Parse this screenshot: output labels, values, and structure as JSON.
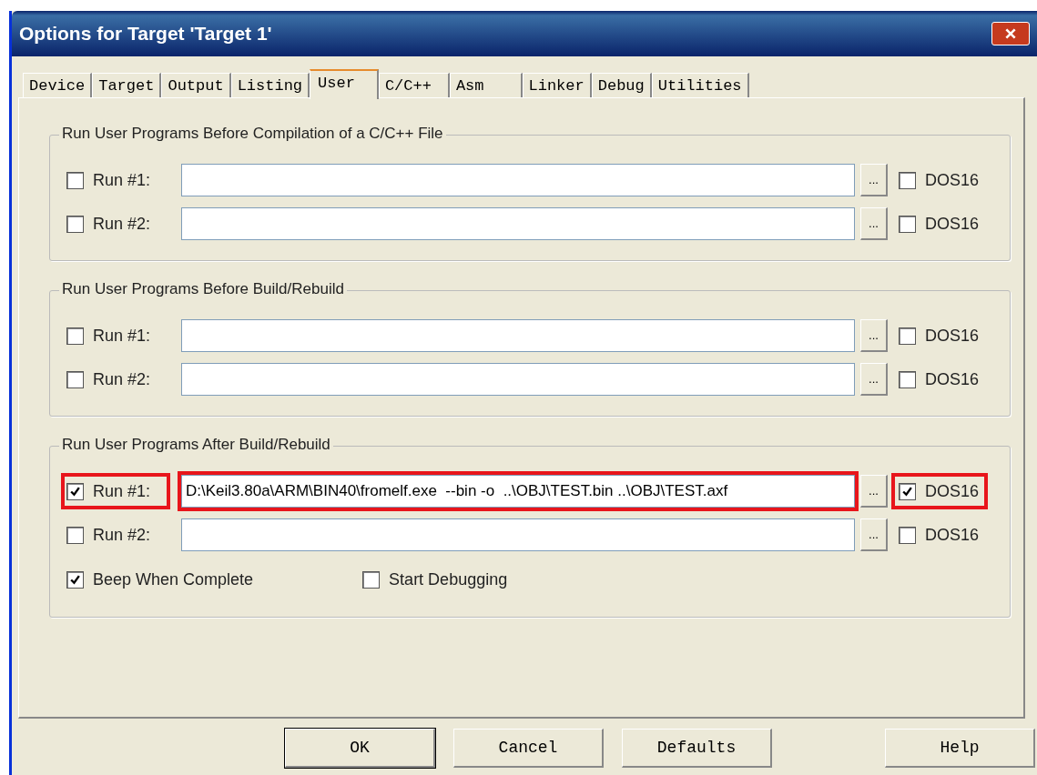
{
  "window": {
    "title": "Options for Target 'Target 1'"
  },
  "tabs": [
    {
      "label": "Device",
      "selected": false
    },
    {
      "label": "Target",
      "selected": false
    },
    {
      "label": "Output",
      "selected": false
    },
    {
      "label": "Listing",
      "selected": false
    },
    {
      "label": "User",
      "selected": true
    },
    {
      "label": "C/C++",
      "selected": false
    },
    {
      "label": "Asm",
      "selected": false
    },
    {
      "label": "Linker",
      "selected": false
    },
    {
      "label": "Debug",
      "selected": false
    },
    {
      "label": "Utilities",
      "selected": false
    }
  ],
  "groups": [
    {
      "title": "Run User Programs Before Compilation of a C/C++ File",
      "rows": [
        {
          "label": "Run #1:",
          "checked": false,
          "value": "",
          "browse": "...",
          "dos_label": "DOS16",
          "dos_checked": false,
          "highlighted": false
        },
        {
          "label": "Run #2:",
          "checked": false,
          "value": "",
          "browse": "...",
          "dos_label": "DOS16",
          "dos_checked": false,
          "highlighted": false
        }
      ]
    },
    {
      "title": "Run User Programs Before Build/Rebuild",
      "rows": [
        {
          "label": "Run #1:",
          "checked": false,
          "value": "",
          "browse": "...",
          "dos_label": "DOS16",
          "dos_checked": false,
          "highlighted": false
        },
        {
          "label": "Run #2:",
          "checked": false,
          "value": "",
          "browse": "...",
          "dos_label": "DOS16",
          "dos_checked": false,
          "highlighted": false
        }
      ]
    },
    {
      "title": "Run User Programs After Build/Rebuild",
      "rows": [
        {
          "label": "Run #1:",
          "checked": true,
          "value": "D:\\Keil3.80a\\ARM\\BIN40\\fromelf.exe  --bin -o  ..\\OBJ\\TEST.bin ..\\OBJ\\TEST.axf",
          "browse": "...",
          "dos_label": "DOS16",
          "dos_checked": true,
          "highlighted": true
        },
        {
          "label": "Run #2:",
          "checked": false,
          "value": "",
          "browse": "...",
          "dos_label": "DOS16",
          "dos_checked": false,
          "highlighted": false
        }
      ],
      "options": [
        {
          "label": "Beep When Complete",
          "checked": true
        },
        {
          "label": "Start Debugging",
          "checked": false
        }
      ]
    }
  ],
  "buttons": [
    {
      "label": "OK",
      "default": true
    },
    {
      "label": "Cancel",
      "default": false
    },
    {
      "label": "Defaults",
      "default": false
    },
    {
      "label": "Help",
      "default": false
    }
  ]
}
